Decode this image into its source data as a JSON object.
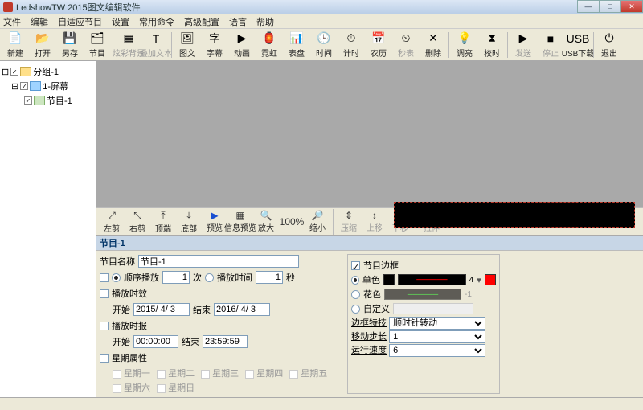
{
  "title": "LedshowTW 2015图文编辑软件",
  "menus": [
    "文件",
    "编辑",
    "自适应节目",
    "设置",
    "常用命令",
    "高级配置",
    "语言",
    "帮助"
  ],
  "toolbar": [
    {
      "i": "📄",
      "t": "新建"
    },
    {
      "i": "📂",
      "t": "打开"
    },
    {
      "i": "💾",
      "t": "另存"
    },
    {
      "i": "🗂",
      "t": "节目"
    },
    {
      "sep": true
    },
    {
      "i": "▦",
      "t": "炫彩背景",
      "d": true
    },
    {
      "i": "T",
      "t": "叠加文本",
      "d": true
    },
    {
      "sep": true
    },
    {
      "i": "🖼",
      "t": "图文"
    },
    {
      "i": "字",
      "t": "字幕"
    },
    {
      "i": "▶",
      "t": "动画"
    },
    {
      "i": "🏮",
      "t": "霓虹"
    },
    {
      "i": "📊",
      "t": "表盘"
    },
    {
      "i": "🕒",
      "t": "时间"
    },
    {
      "i": "⏱",
      "t": "计时"
    },
    {
      "i": "📅",
      "t": "农历"
    },
    {
      "i": "⏲",
      "t": "秒表",
      "d": true
    },
    {
      "i": "✕",
      "t": "删除"
    },
    {
      "sep": true
    },
    {
      "i": "💡",
      "t": "调亮"
    },
    {
      "i": "⧗",
      "t": "校时"
    },
    {
      "sep": true
    },
    {
      "i": "▶",
      "t": "发送",
      "d": true
    },
    {
      "i": "■",
      "t": "停止",
      "d": true
    },
    {
      "i": "USB",
      "t": "USB下载"
    },
    {
      "sep": true
    },
    {
      "i": "⏻",
      "t": "退出"
    }
  ],
  "tree": {
    "root": "分组-1",
    "screen": "1-屏幕",
    "prog": "节目-1"
  },
  "panelToolbar": [
    {
      "i": "⤢",
      "t": "左剪"
    },
    {
      "i": "⤡",
      "t": "右剪"
    },
    {
      "i": "⤒",
      "t": "顶端"
    },
    {
      "i": "⤓",
      "t": "底部"
    },
    {
      "i": "▶",
      "t": "预览",
      "blue": true
    },
    {
      "i": "▦",
      "t": "信息预览"
    },
    {
      "i": "🔍",
      "t": "放大"
    },
    {
      "i": "100%",
      "t": ""
    },
    {
      "i": "🔎",
      "t": "缩小"
    },
    {
      "sep": true
    },
    {
      "i": "⇕",
      "t": "压缩",
      "d": true
    },
    {
      "i": "↕",
      "t": "上移",
      "d": true
    },
    {
      "i": "↕",
      "t": "下移",
      "d": true
    },
    {
      "sep": true
    },
    {
      "i": "⇔",
      "t": "拉伸",
      "d": true
    }
  ],
  "panelCaption": "节目-1",
  "props": {
    "nameLabel": "节目名称",
    "nameValue": "节目-1",
    "orderPlay": "顺序播放",
    "ciLabel": "次",
    "playTime": "播放时间",
    "secLabel": "秒",
    "orderVal": "1",
    "timeVal": "1",
    "playEffect": "播放时效",
    "start": "开始",
    "end": "结束",
    "startDateV": "2015/ 4/ 3",
    "endDateV": "2016/ 4/ 3",
    "playRep": "播放时报",
    "startTimeV": "00:00:00",
    "endTimeV": "23:59:59",
    "weekAttr": "星期属性",
    "weekdays": [
      "星期一",
      "星期二",
      "星期三",
      "星期四",
      "星期五",
      "星期六",
      "星期日"
    ]
  },
  "border": {
    "title": "节目边框",
    "single": "单色",
    "multi": "花色",
    "custom": "自定义",
    "pat1": "4",
    "pat2": "-1",
    "spec": "边框特技",
    "move": "顺时针转动",
    "step": "移动步长",
    "stepV": "1",
    "speed": "运行速度",
    "speedV": "6"
  }
}
